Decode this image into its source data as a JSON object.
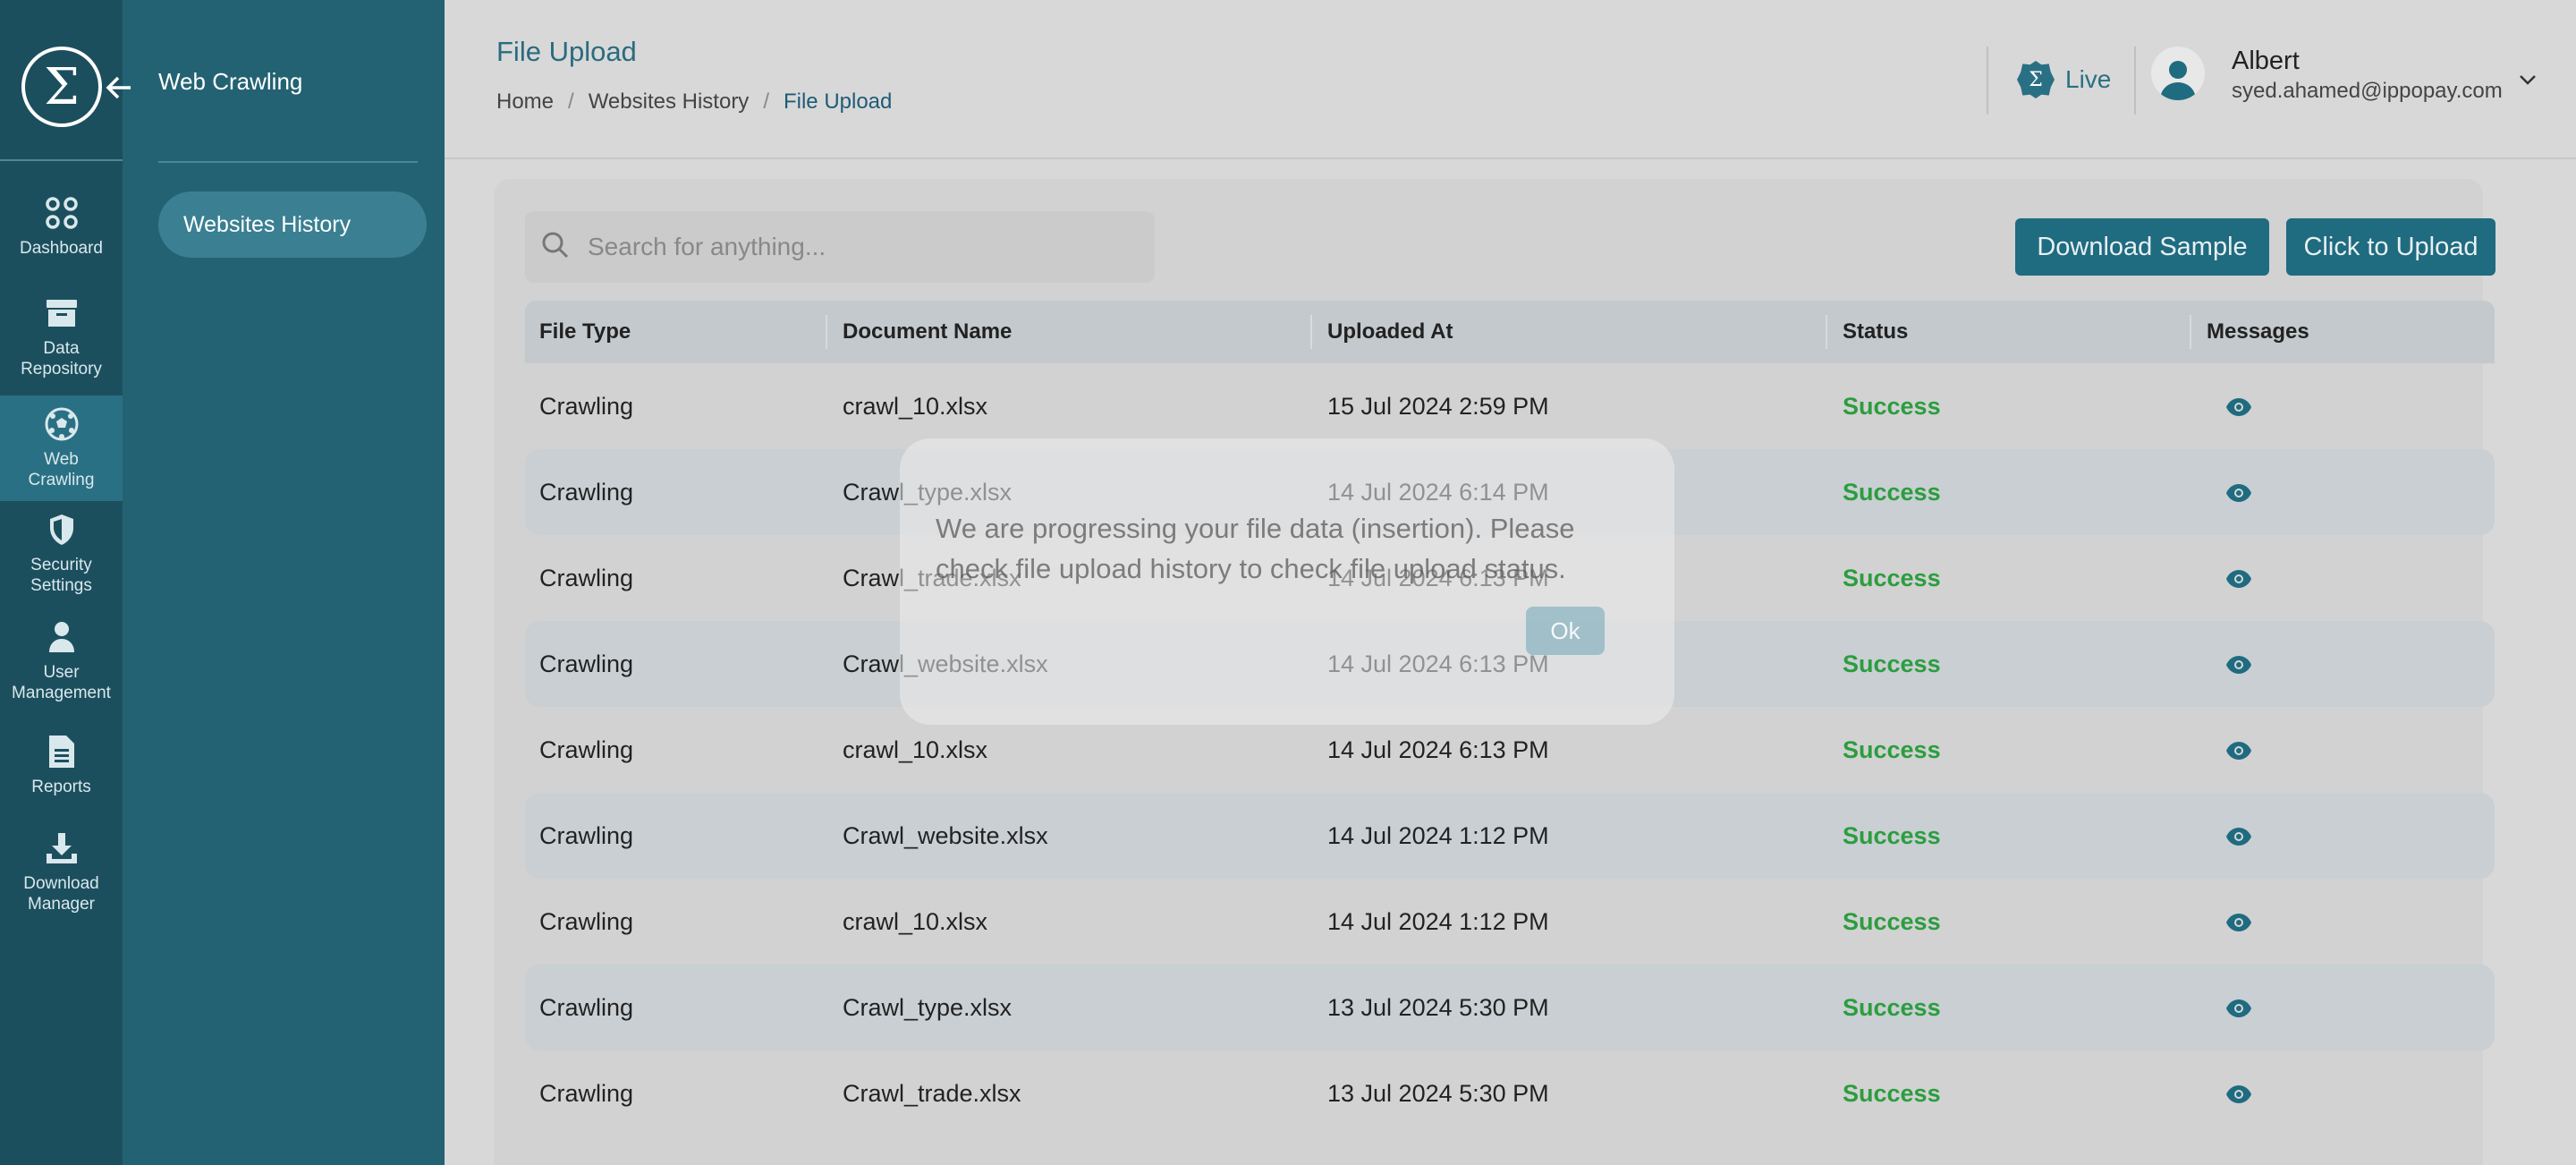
{
  "rail": {
    "items": [
      {
        "label": "Dashboard",
        "icon": "grid-icon"
      },
      {
        "label": "Data\nRepository",
        "icon": "archive-icon"
      },
      {
        "label": "Web\nCrawling",
        "icon": "soccer-ball-icon",
        "active": true
      },
      {
        "label": "Security\nSettings",
        "icon": "shield-icon"
      },
      {
        "label": "User\nManagement",
        "icon": "user-icon"
      },
      {
        "label": "Reports",
        "icon": "document-icon"
      },
      {
        "label": "Download\nManager",
        "icon": "download-icon"
      }
    ]
  },
  "subsidebar": {
    "title": "Web Crawling",
    "items": [
      {
        "label": "Websites History"
      }
    ]
  },
  "header": {
    "title": "File Upload",
    "breadcrumb": [
      "Home",
      "Websites History",
      "File Upload"
    ],
    "live_label": "Live",
    "user_name": "Albert",
    "user_email": "syed.ahamed@ippopay.com"
  },
  "toolbar": {
    "search_placeholder": "Search for anything...",
    "download_label": "Download Sample",
    "upload_label": "Click to Upload"
  },
  "table": {
    "columns": [
      "File Type",
      "Document Name",
      "Uploaded At",
      "Status",
      "Messages"
    ],
    "rows": [
      [
        "Crawling",
        "crawl_10.xlsx",
        "15 Jul 2024 2:59 PM",
        "Success"
      ],
      [
        "Crawling",
        "Crawl_type.xlsx",
        "14 Jul 2024 6:14 PM",
        "Success"
      ],
      [
        "Crawling",
        "Crawl_trade.xlsx",
        "14 Jul 2024 6:13 PM",
        "Success"
      ],
      [
        "Crawling",
        "Crawl_website.xlsx",
        "14 Jul 2024 6:13 PM",
        "Success"
      ],
      [
        "Crawling",
        "crawl_10.xlsx",
        "14 Jul 2024 6:13 PM",
        "Success"
      ],
      [
        "Crawling",
        "Crawl_website.xlsx",
        "14 Jul 2024 1:12 PM",
        "Success"
      ],
      [
        "Crawling",
        "crawl_10.xlsx",
        "14 Jul 2024 1:12 PM",
        "Success"
      ],
      [
        "Crawling",
        "Crawl_type.xlsx",
        "13 Jul 2024 5:30 PM",
        "Success"
      ],
      [
        "Crawling",
        "Crawl_trade.xlsx",
        "13 Jul 2024 5:30 PM",
        "Success"
      ]
    ]
  },
  "modal": {
    "message": "We are progressing your file data (insertion). Please check file upload history to check file upload status.",
    "ok_label": "Ok"
  },
  "colors": {
    "rail_bg": "#1c4f5e",
    "sidebar_bg": "#236272",
    "accent": "#1f6b80",
    "success": "#2c9d3f"
  }
}
